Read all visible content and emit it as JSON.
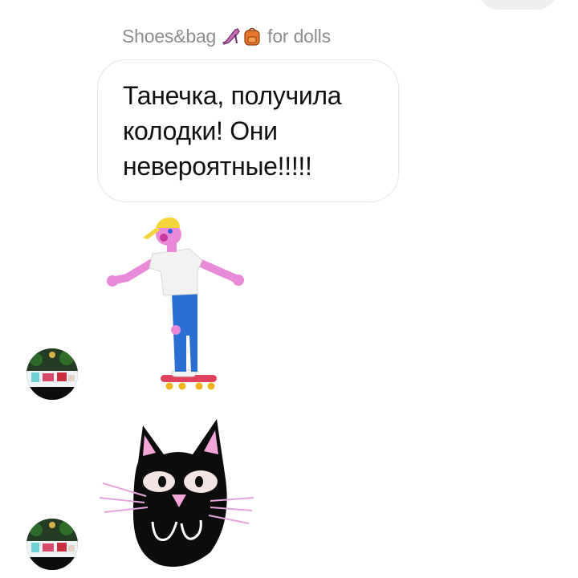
{
  "thread": {
    "sender_name_prefix": "Shoes&bag",
    "sender_name_suffix": "for dolls",
    "sender_emojis": [
      "high-heel-shoe-icon",
      "backpack-icon"
    ]
  },
  "messages": [
    {
      "type": "text",
      "text": "Танечка, получила\nколодки! Они\nневероятные!!!!!"
    },
    {
      "type": "sticker",
      "sticker": "skateboarding-figure-sticker"
    },
    {
      "type": "sticker",
      "sticker": "black-cat-face-sticker"
    }
  ],
  "colors": {
    "sender_text": "#8e8e8e",
    "bubble_border": "#e6e6e6",
    "message_text": "#111111",
    "cat_body": "#0c0c0c",
    "cat_ear_inner": "#f4a6d8",
    "skater_skin": "#e98ad8",
    "skater_cap": "#f3d43b",
    "skater_pants": "#2a6fd1",
    "skateboard": "#e0415d"
  }
}
